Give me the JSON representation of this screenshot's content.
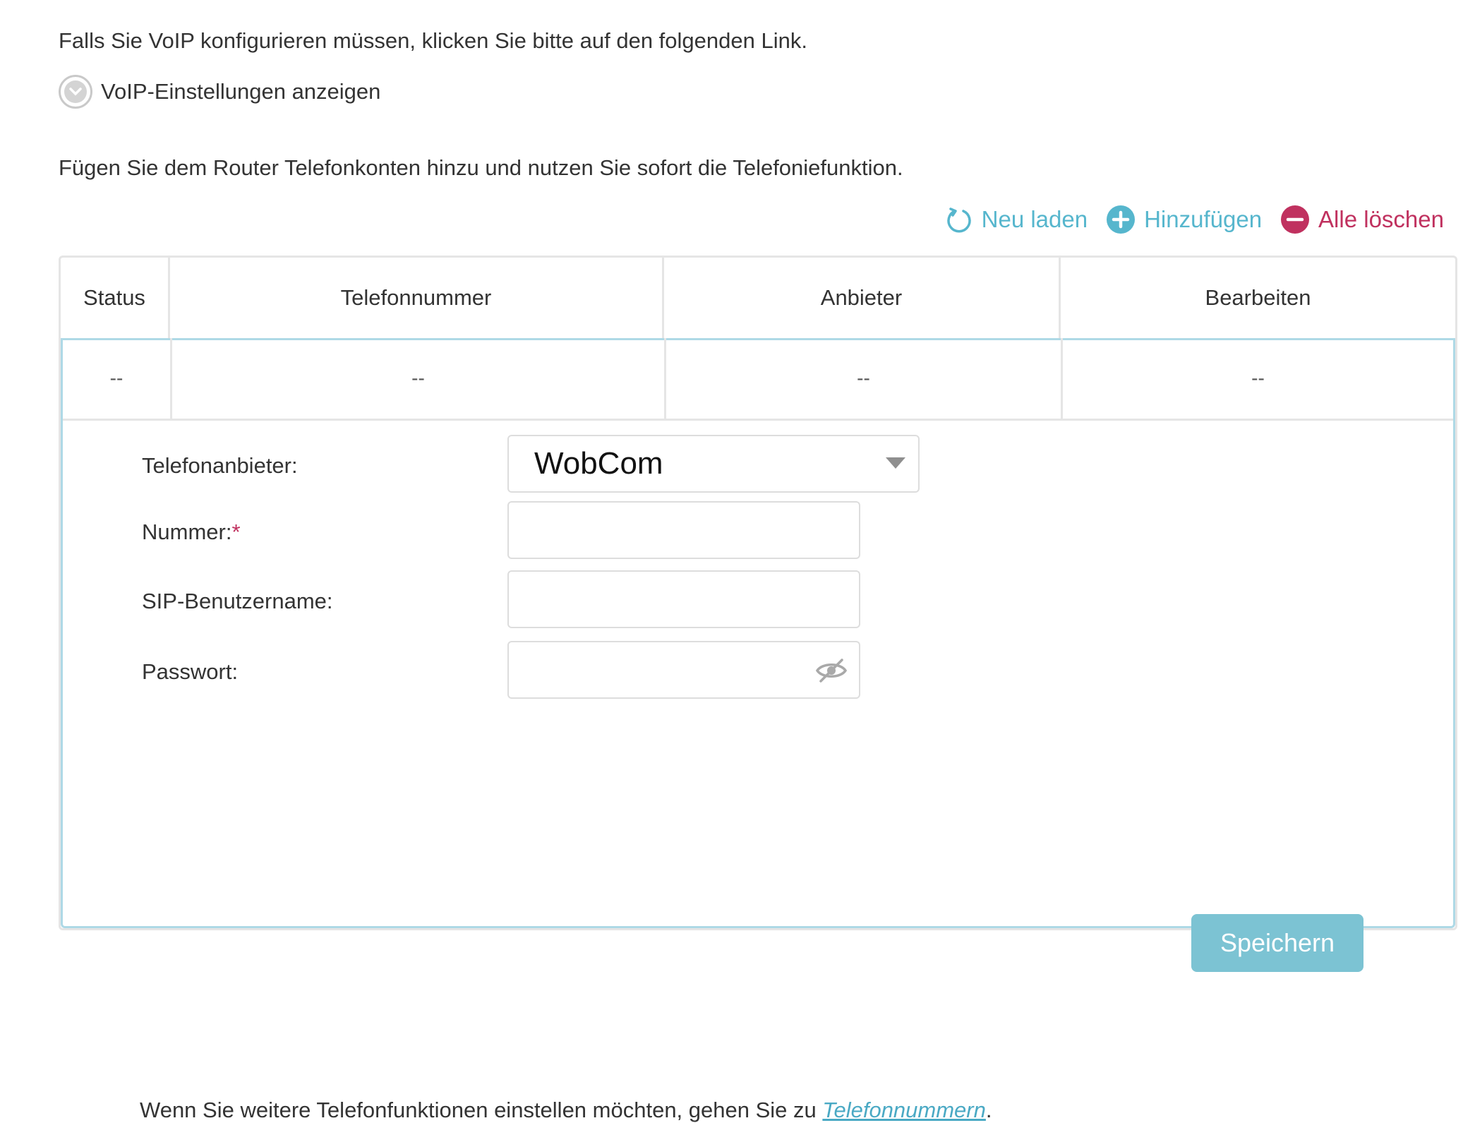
{
  "intro_text": "Falls Sie VoIP konfigurieren müssen, klicken Sie bitte auf den folgenden Link.",
  "voip_toggle_label": "VoIP-Einstellungen anzeigen",
  "description": "Fügen Sie dem Router Telefonkonten hinzu und nutzen Sie sofort die Telefoniefunktion.",
  "actions": {
    "reload": "Neu laden",
    "add": "Hinzufügen",
    "delete_all": "Alle löschen"
  },
  "table": {
    "headers": [
      "Status",
      "Telefonnummer",
      "Anbieter",
      "Bearbeiten"
    ],
    "row": [
      "--",
      "--",
      "--",
      "--"
    ]
  },
  "form": {
    "provider_label": "Telefonanbieter:",
    "provider_value": "WobCom",
    "number_label": "Nummer:",
    "required_mark": "*",
    "number_value": "",
    "sip_label": "SIP-Benutzername:",
    "sip_value": "",
    "password_label": "Passwort:",
    "password_value": ""
  },
  "save_label": "Speichern",
  "footer": {
    "text": "Wenn Sie weitere Telefonfunktionen einstellen möchten, gehen Sie zu ",
    "link": "Telefonnummern",
    "end": "."
  },
  "colors": {
    "accent": "#56b6cd",
    "danger": "#c0315f",
    "button": "#7cc3d3"
  }
}
